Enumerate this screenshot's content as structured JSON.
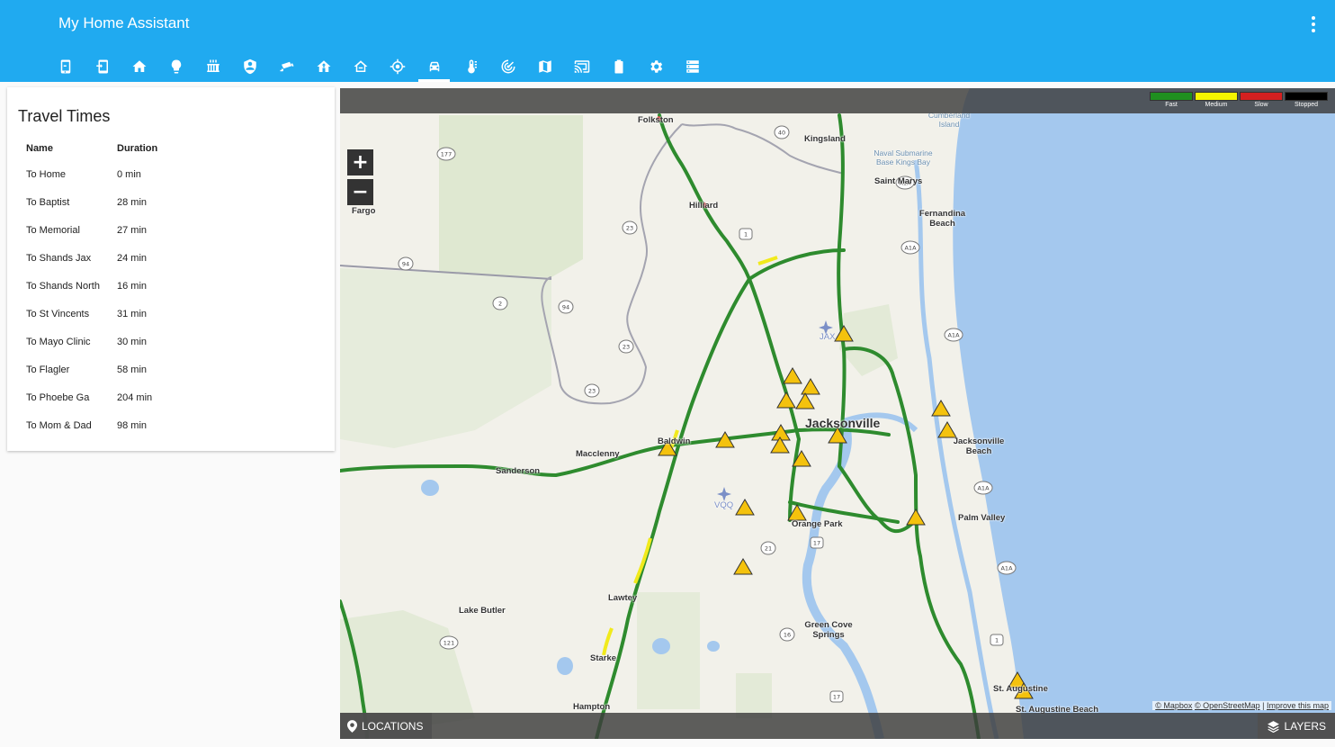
{
  "app": {
    "title": "My Home Assistant",
    "menu_icon": "dots-vertical-icon"
  },
  "tabs": [
    {
      "icon": "tablet-icon"
    },
    {
      "icon": "tablet-exit-icon"
    },
    {
      "icon": "home-icon"
    },
    {
      "icon": "lightbulb-icon"
    },
    {
      "icon": "radiator-icon"
    },
    {
      "icon": "shield-icon"
    },
    {
      "icon": "cctv-icon"
    },
    {
      "icon": "home-up-icon"
    },
    {
      "icon": "home-outline-icon"
    },
    {
      "icon": "crosshair-icon"
    },
    {
      "icon": "car-icon",
      "active": true
    },
    {
      "icon": "thermometer-icon"
    },
    {
      "icon": "radar-icon"
    },
    {
      "icon": "map-icon"
    },
    {
      "icon": "cast-icon"
    },
    {
      "icon": "battery-icon"
    },
    {
      "icon": "settings-icon"
    },
    {
      "icon": "server-icon"
    }
  ],
  "card": {
    "title": "Travel Times",
    "columns": [
      "Name",
      "Duration"
    ],
    "rows": [
      [
        "To Home",
        "0 min"
      ],
      [
        "To Baptist",
        "28 min"
      ],
      [
        "To Memorial",
        "27 min"
      ],
      [
        "To Shands Jax",
        "24 min"
      ],
      [
        "To Shands North",
        "16 min"
      ],
      [
        "To St Vincents",
        "31 min"
      ],
      [
        "To Mayo Clinic",
        "30 min"
      ],
      [
        "To Flagler",
        "58 min"
      ],
      [
        "To Phoebe Ga",
        "204 min"
      ],
      [
        "To Mom & Dad",
        "98 min"
      ]
    ]
  },
  "map": {
    "legend": [
      {
        "label": "Fast",
        "color": "#1f8f1f"
      },
      {
        "label": "Medium",
        "color": "#f5f500"
      },
      {
        "label": "Slow",
        "color": "#d42020"
      },
      {
        "label": "Stopped",
        "color": "#000000"
      }
    ],
    "zoom_in": "+",
    "zoom_out": "−",
    "locations_label": "LOCATIONS",
    "layers_label": "LAYERS",
    "attribution": [
      "© Mapbox",
      "© OpenStreetMap",
      "Improve this map"
    ],
    "places": {
      "folkston": "Folkston",
      "kingsland": "Kingsland",
      "cumberland": "Cumberland Island",
      "naval": "Naval Submarine Base Kings Bay",
      "saint_marys": "Saint Marys",
      "fargo": "Fargo",
      "hilliard": "Hilliard",
      "fernandina": "Fernandina Beach",
      "jax_airport": "JAX",
      "jacksonville": "Jacksonville",
      "jax_beach": "Jacksonville Beach",
      "baldwin": "Baldwin",
      "macclenny": "Macclenny",
      "sanderson": "Sanderson",
      "vqq": "VQQ",
      "orange_park": "Orange Park",
      "palm_valley": "Palm Valley",
      "lake_butler": "Lake Butler",
      "lawtey": "Lawtey",
      "starke": "Starke",
      "hampton": "Hampton",
      "green_cove": "Green Cove Springs",
      "st_augustine": "St. Augustine",
      "st_augustine_beach": "St. Augustine Beach"
    },
    "shields": [
      "177",
      "40",
      "94",
      "23",
      "2",
      "94",
      "23",
      "23",
      "A1A",
      "A1A",
      "A1A",
      "A1A",
      "A1A",
      "21",
      "17",
      "16",
      "121",
      "17",
      "1",
      "1"
    ]
  }
}
